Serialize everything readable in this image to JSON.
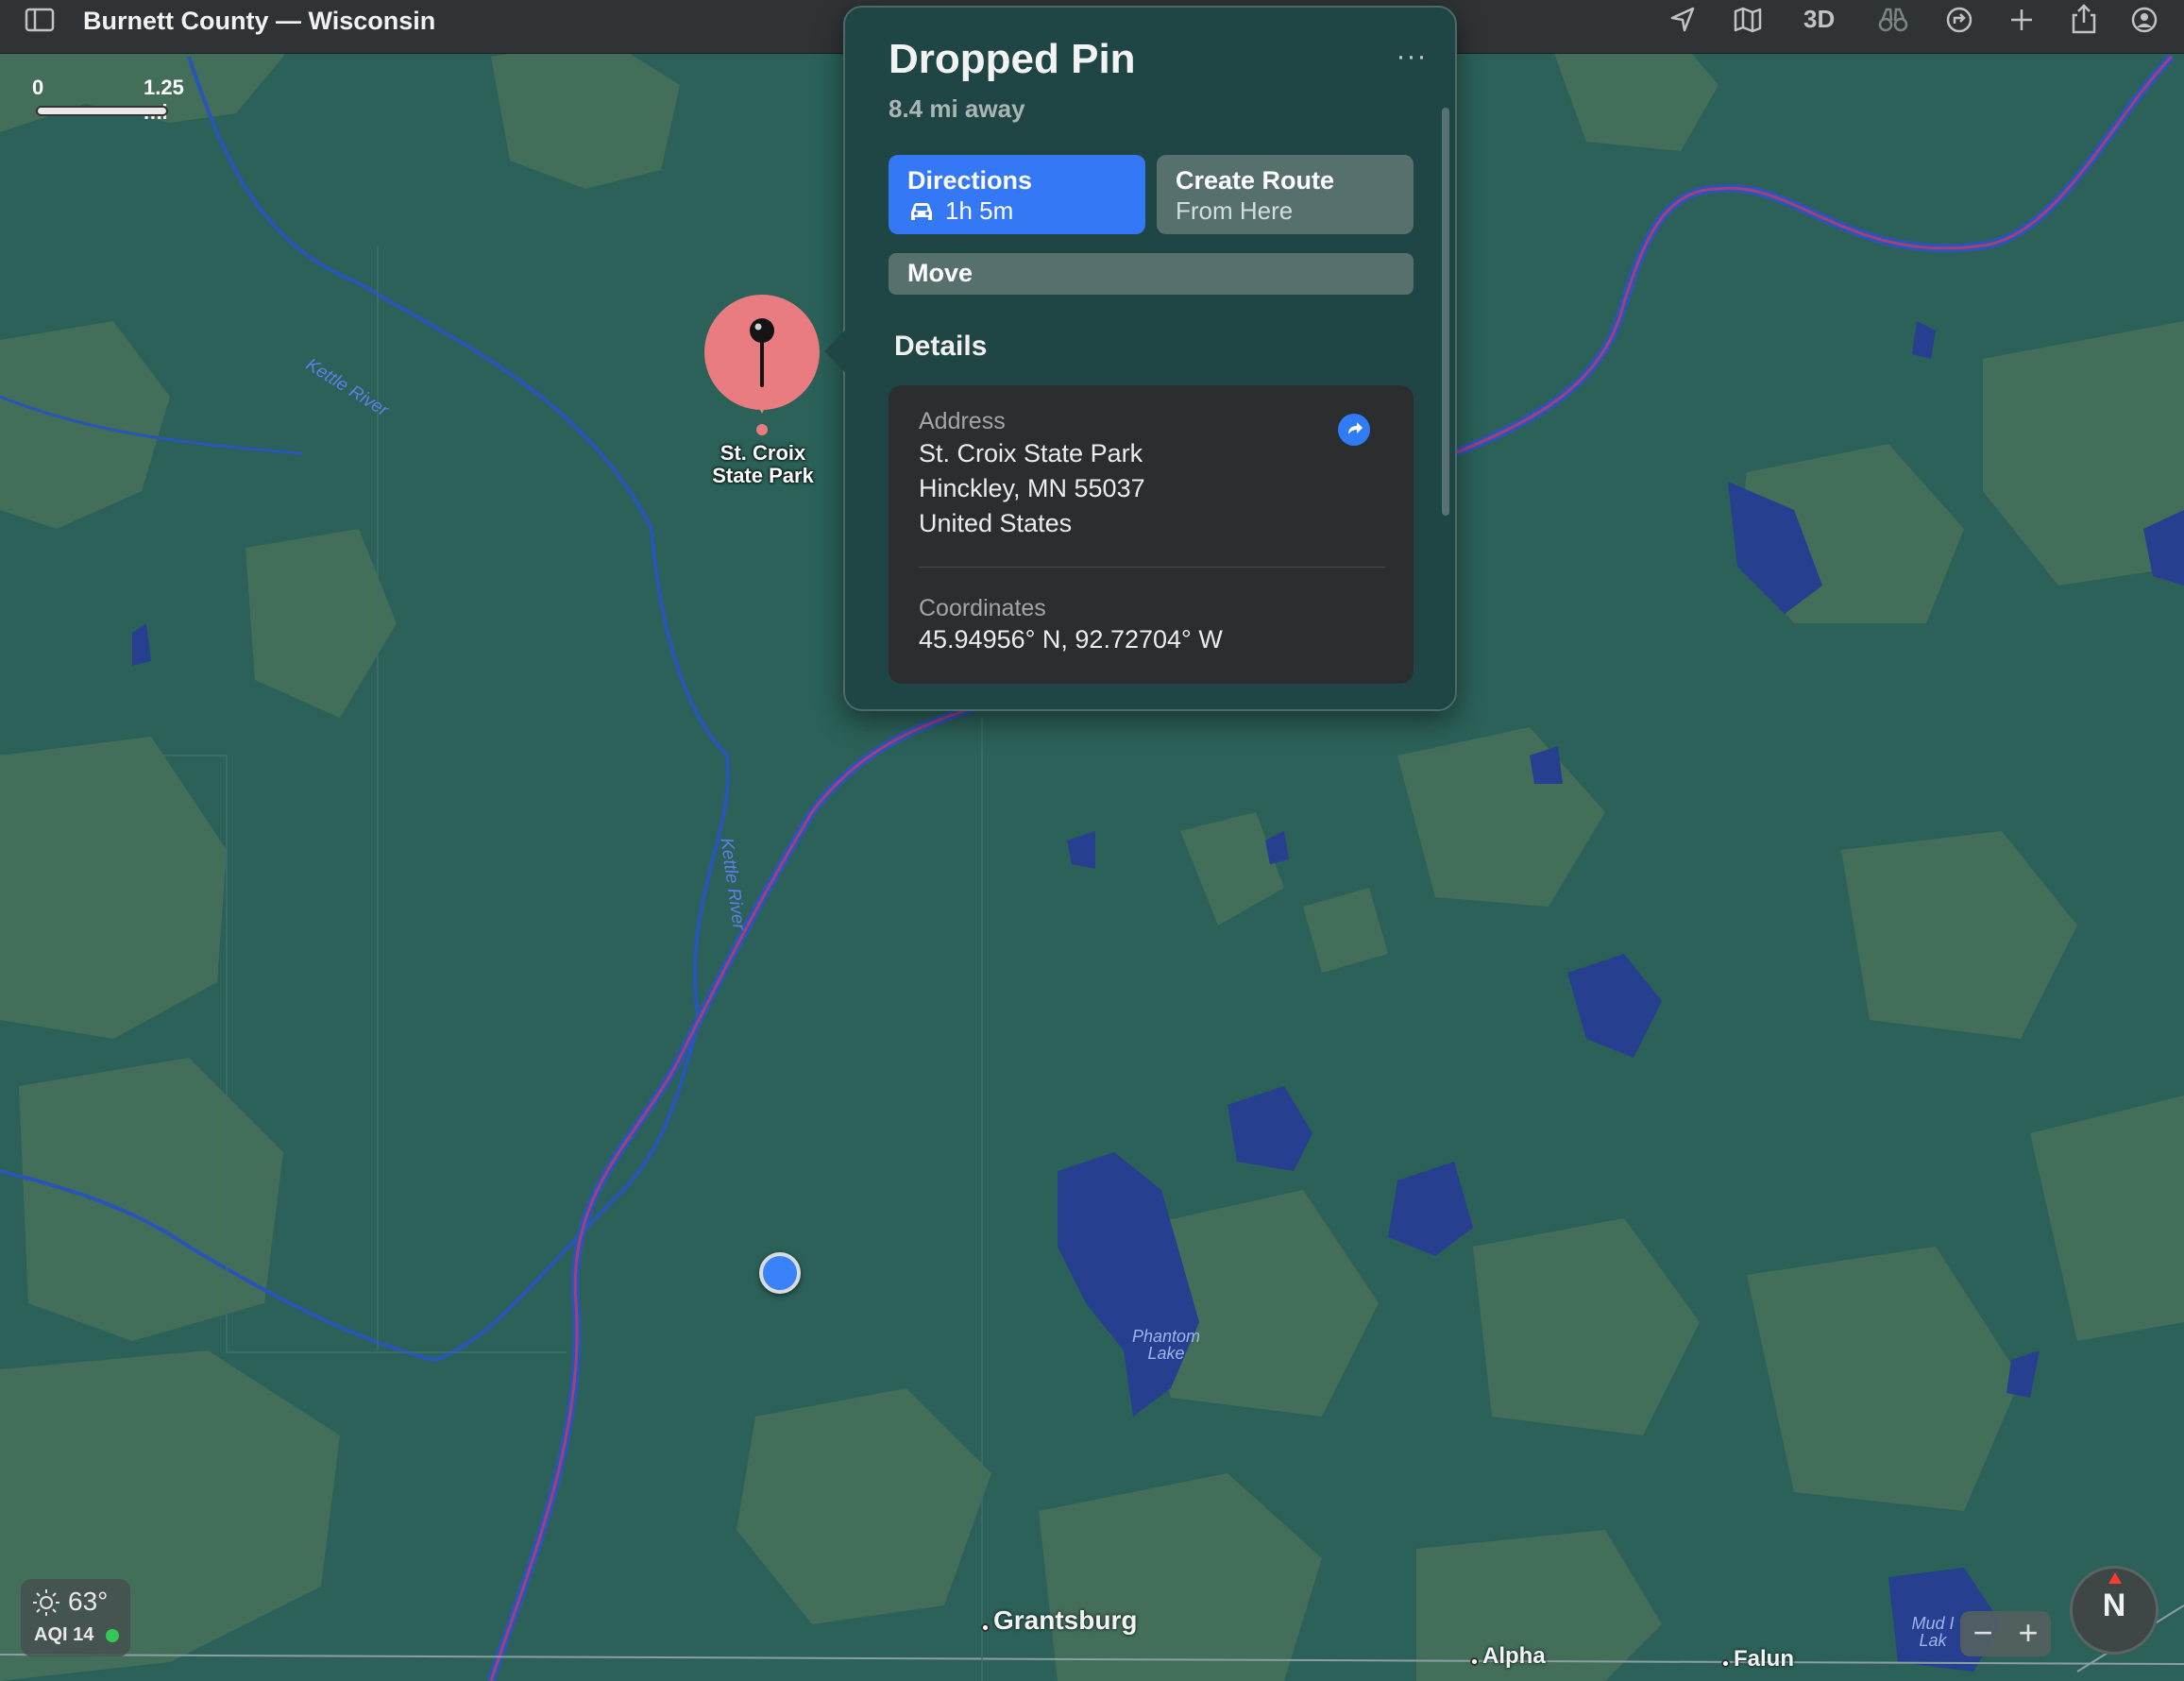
{
  "toolbar": {
    "title": "Burnett County — Wisconsin",
    "view_3d_label": "3D",
    "icons": [
      "sidebar-icon",
      "location-arrow-icon",
      "map-icon",
      "3d-toggle",
      "binoculars-icon",
      "refresh-route-icon",
      "plus-icon",
      "share-icon",
      "account-icon"
    ]
  },
  "scale": {
    "start": "0",
    "end": "1.25 mi"
  },
  "pin": {
    "label_line1": "St. Croix",
    "label_line2": "State Park"
  },
  "popover": {
    "title": "Dropped Pin",
    "distance": "8.4 mi away",
    "more": "···",
    "directions": {
      "label": "Directions",
      "time": "1h 5m"
    },
    "create_route": {
      "label": "Create Route",
      "sub": "From Here"
    },
    "move_label": "Move",
    "details_heading": "Details",
    "address": {
      "label": "Address",
      "line1": "St. Croix State Park",
      "line2": "Hinckley, MN  55037",
      "line3": "United States"
    },
    "coordinates": {
      "label": "Coordinates",
      "value": "45.94956° N, 92.72704° W"
    }
  },
  "map_labels": {
    "kettle_river_1": "Kettle River",
    "kettle_river_2": "Kettle River",
    "phantom_lake_1": "Phantom",
    "phantom_lake_2": "Lake",
    "mud_lake_1": "Mud I",
    "mud_lake_2": "Lak",
    "grantsburg": "Grantsburg",
    "alpha": "Alpha",
    "falun": "Falun"
  },
  "weather": {
    "temp": "63°",
    "aqi": "AQI 14",
    "aqi_color": "#35c759"
  },
  "zoom": {
    "minus": "−",
    "plus": "+"
  },
  "compass": {
    "label": "N"
  },
  "colors": {
    "land": "#2b6158",
    "forest": "#4a7257",
    "water": "#263f8f",
    "river_border": "#a0407c",
    "accent": "#3478f6",
    "pin": "#e97c80"
  }
}
